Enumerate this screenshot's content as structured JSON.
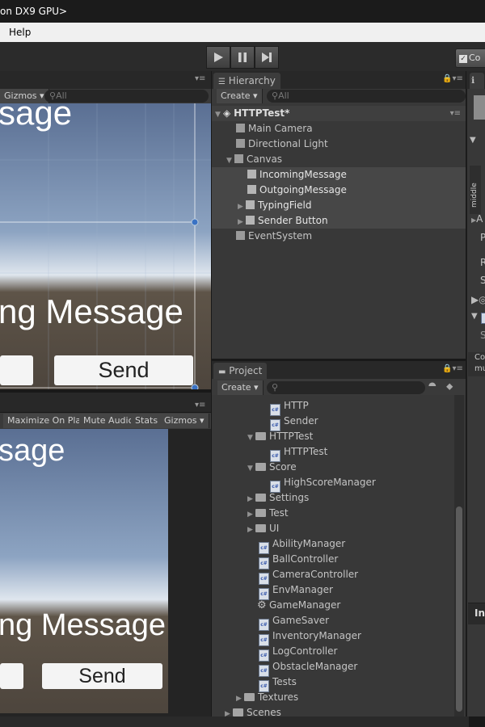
{
  "window": {
    "title": "on DX9 GPU>"
  },
  "menu": {
    "help": "Help"
  },
  "toolbar": {
    "collab_label": "Co"
  },
  "scene_view": {
    "gizmos": "Gizmos",
    "search_placeholder": "All",
    "title_text": "sage",
    "message_text": "ng Message",
    "send_label": "Send"
  },
  "game_view": {
    "maximize_on_play": "Maximize On Play",
    "mute_audio": "Mute Audio",
    "stats": "Stats",
    "gizmos": "Gizmos",
    "title_text": "sage",
    "message_text": "ng Message",
    "send_label": "Send"
  },
  "hierarchy": {
    "tab_label": "Hierarchy",
    "create_label": "Create",
    "search_placeholder": "All",
    "scene_name": "HTTPTest*",
    "items": [
      {
        "label": "Main Camera"
      },
      {
        "label": "Directional Light"
      },
      {
        "label": "Canvas"
      },
      {
        "label": "IncomingMessage"
      },
      {
        "label": "OutgoingMessage"
      },
      {
        "label": "TypingField"
      },
      {
        "label": "Sender Button"
      },
      {
        "label": "EventSystem"
      }
    ]
  },
  "project": {
    "tab_label": "Project",
    "create_label": "Create",
    "items": [
      {
        "label": "HTTP"
      },
      {
        "label": "Sender"
      },
      {
        "label": "HTTPTest"
      },
      {
        "label": "HTTPTest"
      },
      {
        "label": "Score"
      },
      {
        "label": "HighScoreManager"
      },
      {
        "label": "Settings"
      },
      {
        "label": "Test"
      },
      {
        "label": "UI"
      },
      {
        "label": "AbilityManager"
      },
      {
        "label": "BallController"
      },
      {
        "label": "CameraController"
      },
      {
        "label": "EnvManager"
      },
      {
        "label": "GameManager"
      },
      {
        "label": "GameSaver"
      },
      {
        "label": "InventoryManager"
      },
      {
        "label": "LogController"
      },
      {
        "label": "ObstacleManager"
      },
      {
        "label": "Tests"
      },
      {
        "label": "Textures"
      },
      {
        "label": "Scenes"
      }
    ]
  },
  "inspector": {
    "middle_label": "middle",
    "row_a": "A",
    "row_p": "P",
    "row_r": "R",
    "row_s": "S",
    "row_s2": "S",
    "co_label": "Co",
    "mu_label": "mu",
    "in_label": "In"
  },
  "colors": {
    "selection": "#474747",
    "panel": "#383838",
    "accent": "#3a72c4"
  }
}
